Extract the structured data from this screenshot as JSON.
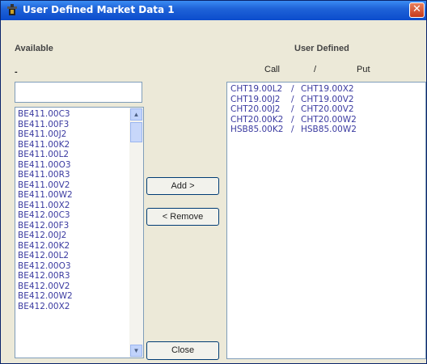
{
  "window": {
    "title": "User Defined Market Data 1",
    "close_glyph": "✕"
  },
  "labels": {
    "available": "Available",
    "user_defined": "User Defined",
    "dash": "-",
    "call": "Call",
    "slash": "/",
    "put": "Put"
  },
  "filter": {
    "value": ""
  },
  "available_list": [
    "BE411.00C3",
    "BE411.00F3",
    "BE411.00J2",
    "BE411.00K2",
    "BE411.00L2",
    "BE411.00O3",
    "BE411.00R3",
    "BE411.00V2",
    "BE411.00W2",
    "BE411.00X2",
    "BE412.00C3",
    "BE412.00F3",
    "BE412.00J2",
    "BE412.00K2",
    "BE412.00L2",
    "BE412.00O3",
    "BE412.00R3",
    "BE412.00V2",
    "BE412.00W2",
    "BE412.00X2"
  ],
  "buttons": {
    "add": "Add >",
    "remove": "< Remove",
    "close": "Close"
  },
  "pairs": [
    {
      "call": "CHT19.00L2",
      "sep": "/",
      "put": "CHT19.00X2"
    },
    {
      "call": "CHT19.00J2",
      "sep": "/",
      "put": "CHT19.00V2"
    },
    {
      "call": "CHT20.00J2",
      "sep": "/",
      "put": "CHT20.00V2"
    },
    {
      "call": "CHT20.00K2",
      "sep": "/",
      "put": "CHT20.00W2"
    },
    {
      "call": "HSB85.00K2",
      "sep": "/",
      "put": "HSB85.00W2"
    }
  ],
  "icons": {
    "title": "app-icon",
    "scroll_up": "arrow-up-icon",
    "scroll_down": "arrow-down-icon"
  }
}
